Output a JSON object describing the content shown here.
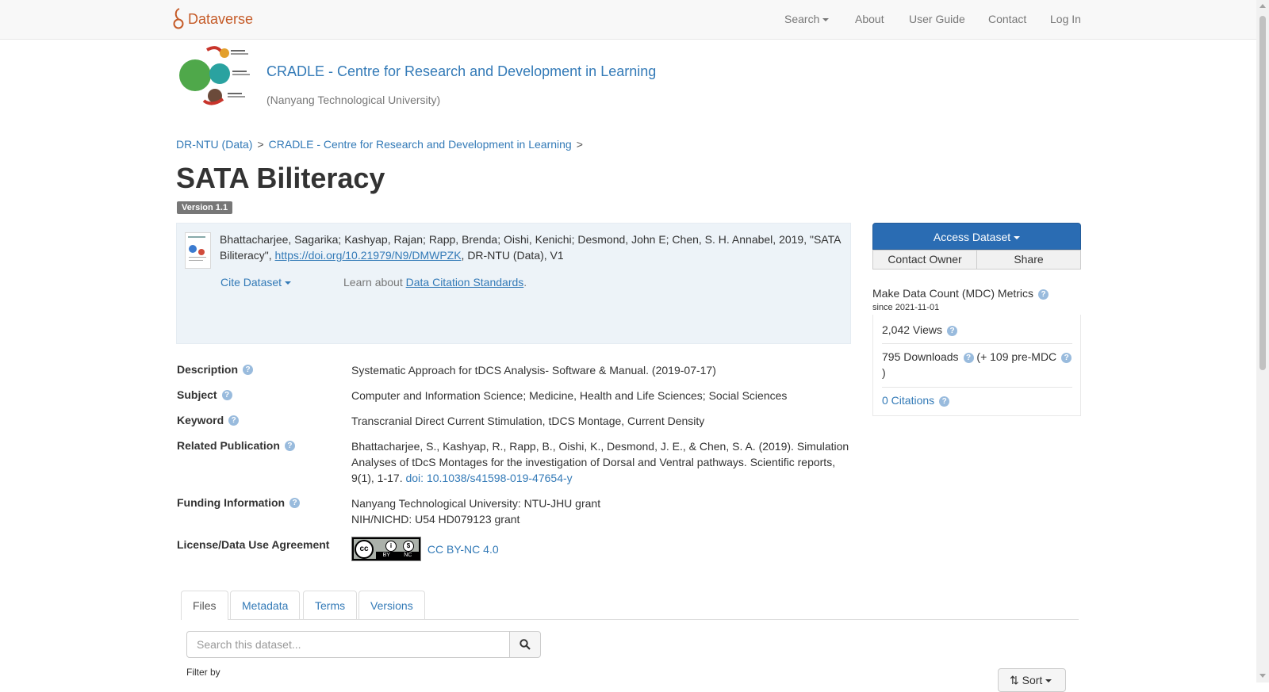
{
  "navbar": {
    "brand": "Dataverse",
    "items": {
      "search": "Search",
      "about": "About",
      "user_guide": "User Guide",
      "contact": "Contact",
      "login": "Log In"
    }
  },
  "dataverse": {
    "title": "CRADLE - Centre for Research and Development in Learning",
    "affiliation": "(Nanyang Technological University)"
  },
  "breadcrumb": {
    "items": [
      "DR-NTU (Data)",
      "CRADLE - Centre for Research and Development in Learning"
    ],
    "separator": ">"
  },
  "dataset": {
    "title": "SATA Biliteracy",
    "version": "Version 1.1"
  },
  "citation": {
    "text_before": "Bhattacharjee, Sagarika; Kashyap, Rajan; Rapp, Brenda; Oishi, Kenichi; Desmond, John E; Chen, S. H. Annabel, 2019, \"SATA Biliteracy\", ",
    "doi_link": "https://doi.org/10.21979/N9/DMWPZK",
    "text_after": ", DR-NTU (Data), V1",
    "cite_dropdown": "Cite Dataset",
    "learn_prefix": "Learn about ",
    "learn_link": "Data Citation Standards",
    "learn_suffix": "."
  },
  "metadata": {
    "description": {
      "label": "Description",
      "value": "Systematic Approach for tDCS Analysis- Software & Manual. (2019-07-17)"
    },
    "subject": {
      "label": "Subject",
      "value": "Computer and Information Science; Medicine, Health and Life Sciences; Social Sciences"
    },
    "keyword": {
      "label": "Keyword",
      "value": "Transcranial Direct Current Stimulation, tDCS Montage, Current Density"
    },
    "related_publication": {
      "label": "Related Publication",
      "value": "Bhattacharjee, S., Kashyap, R., Rapp, B., Oishi, K., Desmond, J. E., & Chen, S. A. (2019). Simulation Analyses of tDcS Montages for the investigation of Dorsal and Ventral pathways. Scientific reports, 9(1), 1-17. ",
      "link": "doi: 10.1038/s41598-019-47654-y"
    },
    "funding": {
      "label": "Funding Information",
      "line1": "Nanyang Technological University: NTU-JHU grant",
      "line2": "NIH/NICHD: U54 HD079123 grant"
    },
    "license": {
      "label": "License/Data Use Agreement",
      "badge_text": [
        "cc",
        "BY",
        "NC"
      ],
      "value": "CC BY-NC 4.0"
    }
  },
  "sidebar": {
    "access_dataset": "Access Dataset",
    "contact_owner": "Contact Owner",
    "share": "Share",
    "mdc_title": "Make Data Count (MDC) Metrics",
    "mdc_since": "since 2021-11-01",
    "views": "2,042 Views",
    "downloads": "795 Downloads",
    "pre_mdc": "(+ 109 pre-MDC",
    "pre_mdc_close": ")",
    "citations": "0 Citations"
  },
  "tabs": [
    "Files",
    "Metadata",
    "Terms",
    "Versions"
  ],
  "files": {
    "search_placeholder": "Search this dataset...",
    "filter_label": "Filter by",
    "sort_label": "Sort"
  },
  "colors": {
    "brand": "#c55b28",
    "link": "#337ab7",
    "access_button": "#2a6cb3",
    "citation_bg": "#edf3f8"
  },
  "icons": {
    "brand": "dataverse-logo-icon",
    "help": "question-circle-icon",
    "search": "search-icon",
    "sort": "sort-icon"
  }
}
